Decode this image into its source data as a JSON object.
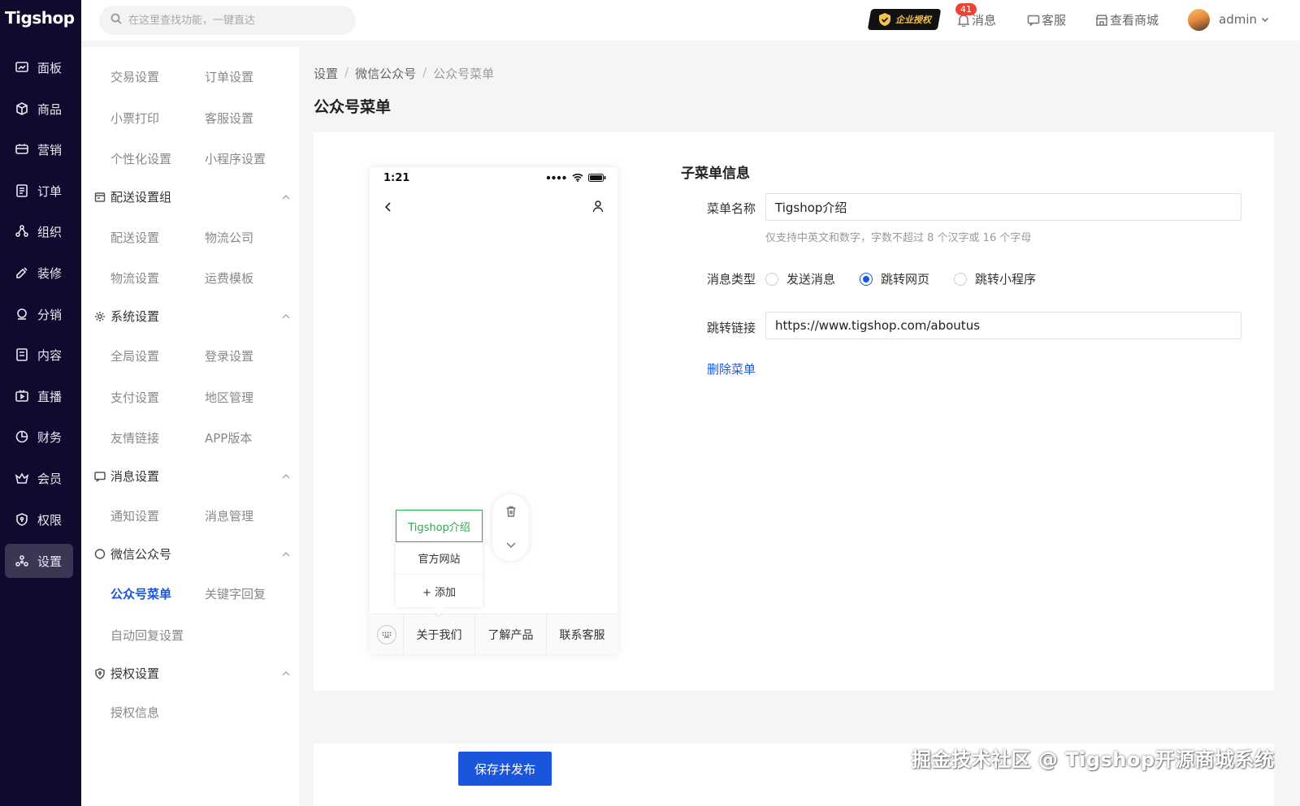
{
  "app": {
    "logo": "Tigshop"
  },
  "sidebar": {
    "items": [
      {
        "label": "面板",
        "icon": "dashboard-icon"
      },
      {
        "label": "商品",
        "icon": "box-icon"
      },
      {
        "label": "营销",
        "icon": "marketing-icon"
      },
      {
        "label": "订单",
        "icon": "order-icon"
      },
      {
        "label": "组织",
        "icon": "organization-icon"
      },
      {
        "label": "装修",
        "icon": "decorate-icon"
      },
      {
        "label": "分销",
        "icon": "distribution-icon"
      },
      {
        "label": "内容",
        "icon": "content-icon"
      },
      {
        "label": "直播",
        "icon": "live-icon"
      },
      {
        "label": "财务",
        "icon": "finance-icon"
      },
      {
        "label": "会员",
        "icon": "member-icon"
      },
      {
        "label": "权限",
        "icon": "permission-icon"
      },
      {
        "label": "设置",
        "icon": "settings-icon",
        "active": true
      }
    ]
  },
  "header": {
    "search_placeholder": "在这里查找功能，一键直达",
    "auth_badge": "企业授权",
    "message_count": "41",
    "message_label": "消息",
    "service_label": "客服",
    "view_shop_label": "查看商城",
    "user_name": "admin"
  },
  "submenu": {
    "top_links": [
      "交易设置",
      "订单设置",
      "小票打印",
      "客服设置",
      "个性化设置",
      "小程序设置"
    ],
    "groups": [
      {
        "title": "配送设置组",
        "icon": "delivery-icon",
        "links": [
          "配送设置",
          "物流公司",
          "物流设置",
          "运费模板"
        ]
      },
      {
        "title": "系统设置",
        "icon": "system-gear-icon",
        "links": [
          "全局设置",
          "登录设置",
          "支付设置",
          "地区管理",
          "友情链接",
          "APP版本"
        ]
      },
      {
        "title": "消息设置",
        "icon": "message-icon",
        "links": [
          "通知设置",
          "消息管理"
        ]
      },
      {
        "title": "微信公众号",
        "icon": "wechat-icon",
        "links": [
          "公众号菜单",
          "关键字回复",
          "自动回复设置"
        ],
        "active": "公众号菜单"
      },
      {
        "title": "授权设置",
        "icon": "shield-icon",
        "links": [
          "授权信息"
        ]
      }
    ]
  },
  "breadcrumb": [
    "设置",
    "微信公众号",
    "公众号菜单"
  ],
  "page_title": "公众号菜单",
  "phone": {
    "time": "1:21",
    "popup_items": [
      "Tigshop介绍",
      "官方网站",
      "+ 添加"
    ],
    "bottom_tabs": [
      "关于我们",
      "了解产品",
      "联系客服"
    ]
  },
  "form": {
    "section_title": "子菜单信息",
    "name_label": "菜单名称",
    "name_value": "Tigshop介绍",
    "name_hint": "仅支持中英文和数字，字数不超过 8 个汉字或 16 个字母",
    "type_label": "消息类型",
    "type_options": [
      "发送消息",
      "跳转网页",
      "跳转小程序"
    ],
    "type_selected": "跳转网页",
    "link_label": "跳转链接",
    "link_value": "https://www.tigshop.com/aboutus",
    "delete_label": "删除菜单"
  },
  "footer": {
    "save_label": "保存并发布"
  },
  "watermark": "掘金技术社区 @ Tigshop开源商城系统",
  "colors": {
    "sidebar_bg": "#0f0b2e",
    "primary": "#1a56db",
    "selected_green": "#2fa84f",
    "badge_red": "#f04134"
  }
}
